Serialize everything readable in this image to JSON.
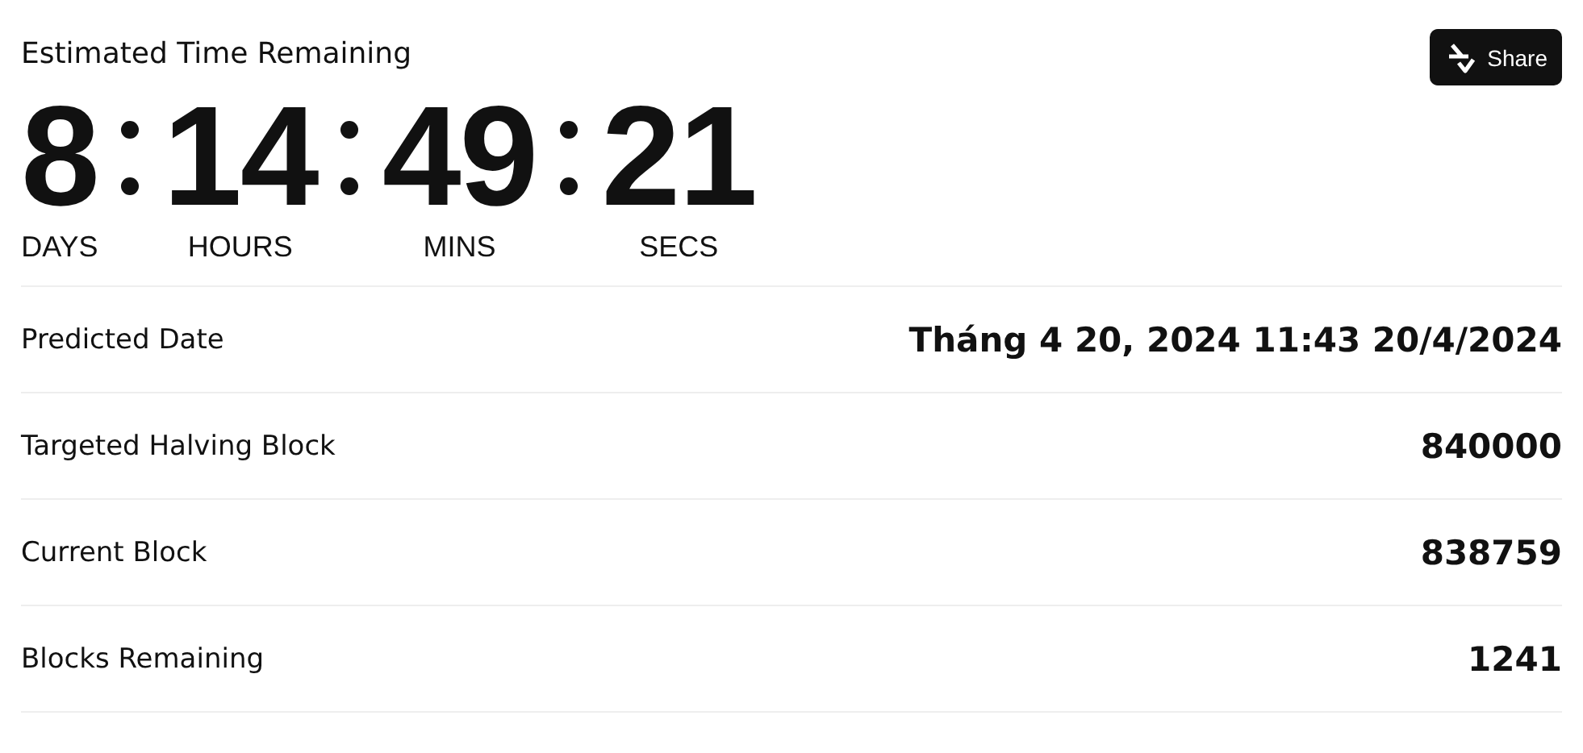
{
  "countdown": {
    "title": "Estimated Time Remaining",
    "share_button": "Share",
    "units": [
      {
        "value": "8",
        "label": "DAYS"
      },
      {
        "value": "14",
        "label": "HOURS"
      },
      {
        "value": "49",
        "label": "MINS"
      },
      {
        "value": "21",
        "label": "SECS"
      }
    ]
  },
  "details": [
    {
      "label": "Predicted Date",
      "value": "Tháng 4 20, 2024 11:43 20/4/2024"
    },
    {
      "label": "Targeted Halving Block",
      "value": "840000"
    },
    {
      "label": "Current Block",
      "value": "838759"
    },
    {
      "label": "Blocks Remaining",
      "value": "1241"
    }
  ]
}
